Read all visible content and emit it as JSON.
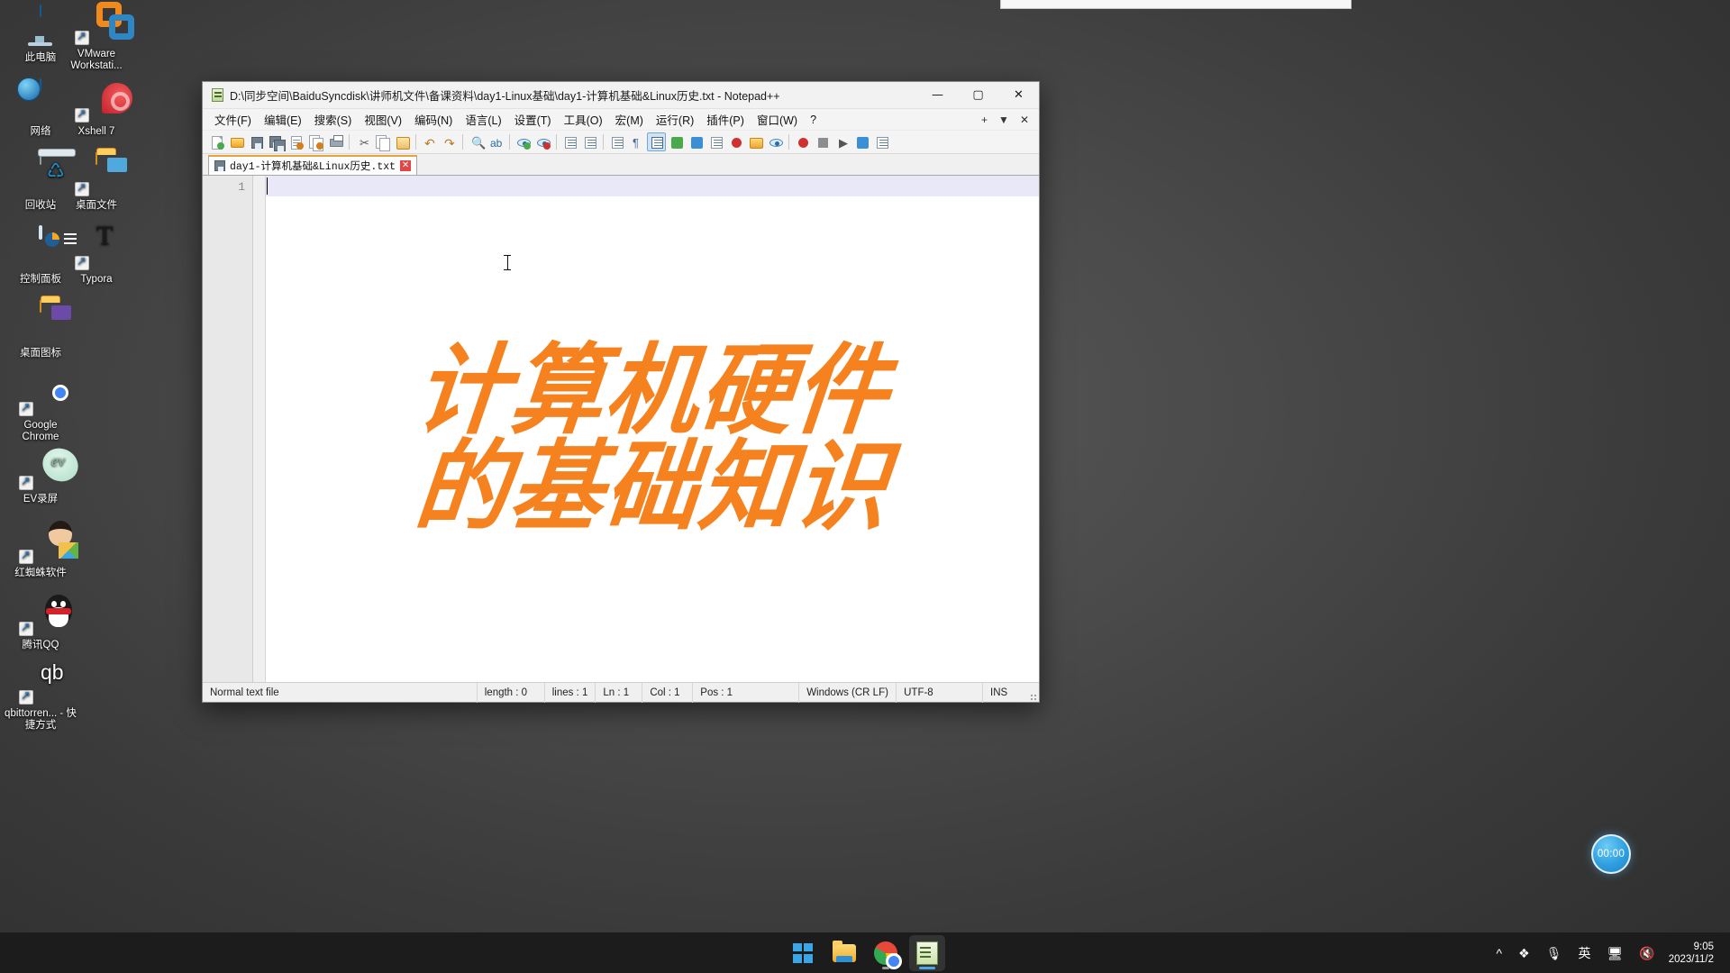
{
  "desktop": {
    "icons": [
      {
        "id": "this-pc",
        "label": "此电脑",
        "art": "monitor",
        "shortcut": false
      },
      {
        "id": "vmware",
        "label": "VMware Workstati...",
        "art": "vmware",
        "shortcut": true
      },
      {
        "id": "network",
        "label": "网络",
        "art": "network",
        "shortcut": false
      },
      {
        "id": "xshell",
        "label": "Xshell 7",
        "art": "xshell",
        "shortcut": true
      },
      {
        "id": "recycle-bin",
        "label": "回收站",
        "art": "recycle",
        "shortcut": false
      },
      {
        "id": "desktop-files",
        "label": "桌面文件",
        "art": "folder-blue",
        "shortcut": true
      },
      {
        "id": "control-panel",
        "label": "控制面板",
        "art": "ctrlpanel",
        "shortcut": false
      },
      {
        "id": "typora",
        "label": "Typora",
        "art": "typora",
        "shortcut": true
      },
      {
        "id": "desktop-icons-folder",
        "label": "桌面图标",
        "art": "folder-purple",
        "shortcut": false
      },
      {
        "id": "google-chrome",
        "label": "Google Chrome",
        "art": "chrome",
        "shortcut": true
      },
      {
        "id": "ev-recorder",
        "label": "EV录屏",
        "art": "ev",
        "shortcut": true
      },
      {
        "id": "red-spider",
        "label": "红蜘蛛软件",
        "art": "spider",
        "shortcut": true
      },
      {
        "id": "tencent-qq",
        "label": "腾讯QQ",
        "art": "qq",
        "shortcut": true
      },
      {
        "id": "qbittorrent",
        "label": "qbittorren... - 快捷方式",
        "art": "qb",
        "shortcut": true
      }
    ]
  },
  "notepad": {
    "title": "D:\\同步空间\\BaiduSyncdisk\\讲师机文件\\备课资料\\day1-Linux基础\\day1-计算机基础&Linux历史.txt - Notepad++",
    "window_buttons": {
      "minimize": "—",
      "maximize": "▢",
      "close": "✕"
    },
    "menu": [
      {
        "id": "file",
        "label": "文件(F)"
      },
      {
        "id": "edit",
        "label": "编辑(E)"
      },
      {
        "id": "search",
        "label": "搜索(S)"
      },
      {
        "id": "view",
        "label": "视图(V)"
      },
      {
        "id": "encoding",
        "label": "编码(N)"
      },
      {
        "id": "language",
        "label": "语言(L)"
      },
      {
        "id": "settings",
        "label": "设置(T)"
      },
      {
        "id": "tools",
        "label": "工具(O)"
      },
      {
        "id": "macro",
        "label": "宏(M)"
      },
      {
        "id": "run",
        "label": "运行(R)"
      },
      {
        "id": "plugins",
        "label": "插件(P)"
      },
      {
        "id": "window",
        "label": "窗口(W)"
      },
      {
        "id": "help",
        "label": "?"
      }
    ],
    "menu_right": {
      "add": "+",
      "dropdown": "▼",
      "close": "✕"
    },
    "toolbar": [
      {
        "id": "new",
        "icon": "new-file-icon"
      },
      {
        "id": "open",
        "icon": "open-folder-icon"
      },
      {
        "id": "save",
        "icon": "save-icon"
      },
      {
        "id": "save-all",
        "icon": "save-all-icon"
      },
      {
        "id": "close",
        "icon": "close-file-icon"
      },
      {
        "id": "close-all",
        "icon": "close-all-files-icon"
      },
      {
        "id": "print",
        "icon": "print-icon"
      },
      {
        "id": "sep1",
        "icon": "separator"
      },
      {
        "id": "cut",
        "icon": "cut-icon"
      },
      {
        "id": "copy",
        "icon": "copy-icon"
      },
      {
        "id": "paste",
        "icon": "paste-icon"
      },
      {
        "id": "sep2",
        "icon": "separator"
      },
      {
        "id": "undo",
        "icon": "undo-icon"
      },
      {
        "id": "redo",
        "icon": "redo-icon"
      },
      {
        "id": "sep3",
        "icon": "separator"
      },
      {
        "id": "find",
        "icon": "find-icon"
      },
      {
        "id": "replace",
        "icon": "replace-icon"
      },
      {
        "id": "sep4",
        "icon": "separator"
      },
      {
        "id": "zoom-in",
        "icon": "zoom-in-icon"
      },
      {
        "id": "zoom-out",
        "icon": "zoom-out-icon"
      },
      {
        "id": "sep5",
        "icon": "separator"
      },
      {
        "id": "sync-v",
        "icon": "sync-vertical-icon"
      },
      {
        "id": "sync-h",
        "icon": "sync-horizontal-icon"
      },
      {
        "id": "sep6",
        "icon": "separator"
      },
      {
        "id": "wordwrap",
        "icon": "word-wrap-icon"
      },
      {
        "id": "invisible-chars",
        "icon": "show-all-characters-icon"
      },
      {
        "id": "indent-guide",
        "icon": "indent-guide-icon"
      },
      {
        "id": "uppercase",
        "icon": "uppercase-icon"
      },
      {
        "id": "show-symbol",
        "icon": "eye-icon"
      },
      {
        "id": "sep7",
        "icon": "separator"
      },
      {
        "id": "record-macro",
        "icon": "record-macro-icon"
      },
      {
        "id": "stop-macro",
        "icon": "stop-macro-icon"
      },
      {
        "id": "playback-macro",
        "icon": "play-macro-icon"
      },
      {
        "id": "run-macro-many",
        "icon": "run-multiple-icon"
      },
      {
        "id": "save-macro",
        "icon": "save-macro-icon"
      }
    ],
    "tab": {
      "label": "day1-计算机基础&Linux历史.txt",
      "close": "✕"
    },
    "gutter": {
      "line_numbers": [
        "1"
      ]
    },
    "document": {
      "hero_lines": [
        "计算机硬件",
        "的基础知识"
      ],
      "hero_color": "#F5821F"
    },
    "statusbar": {
      "file_type": "Normal text file",
      "length_label": "length : 0",
      "lines_label": "lines : 1",
      "ln": "Ln : 1",
      "col": "Col : 1",
      "pos": "Pos : 1",
      "eol": "Windows (CR LF)",
      "encoding": "UTF-8",
      "insert_mode": "INS"
    }
  },
  "timer": {
    "value": "00:00"
  },
  "taskbar": {
    "apps": [
      {
        "id": "start",
        "name": "windows-start-icon",
        "active": false,
        "accent": "#3aa6e8"
      },
      {
        "id": "file-explorer",
        "name": "file-explorer-icon",
        "active": false,
        "accent": "#f0ab2b"
      },
      {
        "id": "chrome",
        "name": "chrome-icon",
        "active": true,
        "accent": "#9a9a9a"
      },
      {
        "id": "notepadpp",
        "name": "notepad-plus-plus-icon",
        "active": true,
        "accent": "#4aa8e8"
      }
    ],
    "tray": [
      {
        "id": "show-hidden",
        "glyph": "^",
        "name": "show-hidden-icons-chevron"
      },
      {
        "id": "widgets",
        "glyph": "❖",
        "name": "widgets-icon"
      },
      {
        "id": "microphone",
        "glyph": "🎙",
        "name": "microphone-icon"
      },
      {
        "id": "ime",
        "glyph": "英",
        "name": "ime-language-icon"
      },
      {
        "id": "network",
        "glyph": "🖥",
        "name": "network-icon"
      },
      {
        "id": "volume",
        "glyph": "🔇",
        "name": "volume-muted-icon"
      }
    ],
    "clock": {
      "time": "9:05",
      "date": "2023/11/2"
    }
  }
}
